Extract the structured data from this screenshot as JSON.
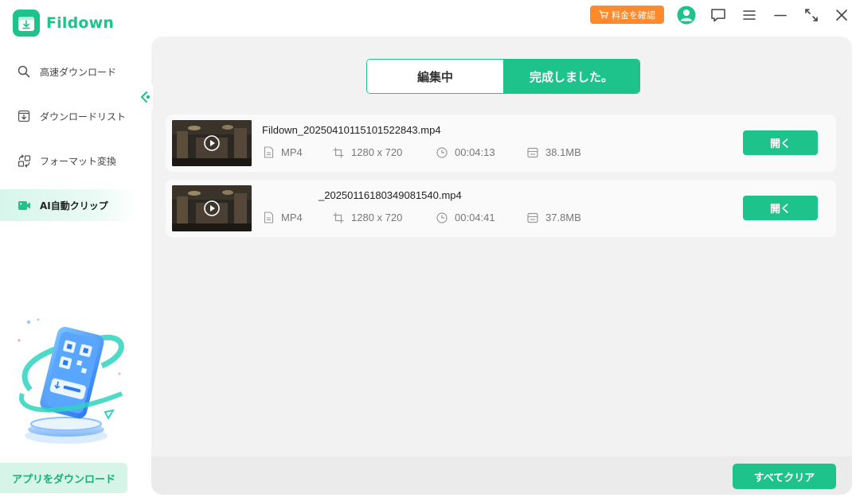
{
  "app": {
    "name": "Fildown"
  },
  "titlebar": {
    "price_label": "料金を確認",
    "icons": [
      "user-icon",
      "feedback-icon",
      "menu-icon",
      "minimize-icon",
      "maximize-icon",
      "close-icon"
    ]
  },
  "sidebar": {
    "items": [
      {
        "label": "高速ダウンロード",
        "icon": "search-icon",
        "active": false
      },
      {
        "label": "ダウンロードリスト",
        "icon": "download-list-icon",
        "active": false
      },
      {
        "label": "フォーマット変換",
        "icon": "convert-icon",
        "active": false
      },
      {
        "label": "AI自動クリップ",
        "icon": "ai-clip-icon",
        "active": true
      }
    ],
    "app_download_label": "アプリをダウンロード"
  },
  "tabs": [
    {
      "label": "編集中",
      "active": false
    },
    {
      "label": "完成しました。",
      "active": true
    }
  ],
  "files": [
    {
      "name": "Fildown_20250410115101522843.mp4",
      "format": "MP4",
      "resolution": "1280 x 720",
      "duration": "00:04:13",
      "size": "38.1MB",
      "open_label": "開く"
    },
    {
      "name": "_20250116180349081540.mp4",
      "format": "MP4",
      "resolution": "1280 x 720",
      "duration": "00:04:41",
      "size": "37.8MB",
      "open_label": "開く"
    }
  ],
  "footer": {
    "clear_all_label": "すべてクリア"
  },
  "colors": {
    "accent": "#1ec28b",
    "price": "#ff8a2b",
    "panel": "#f2f2f2"
  }
}
